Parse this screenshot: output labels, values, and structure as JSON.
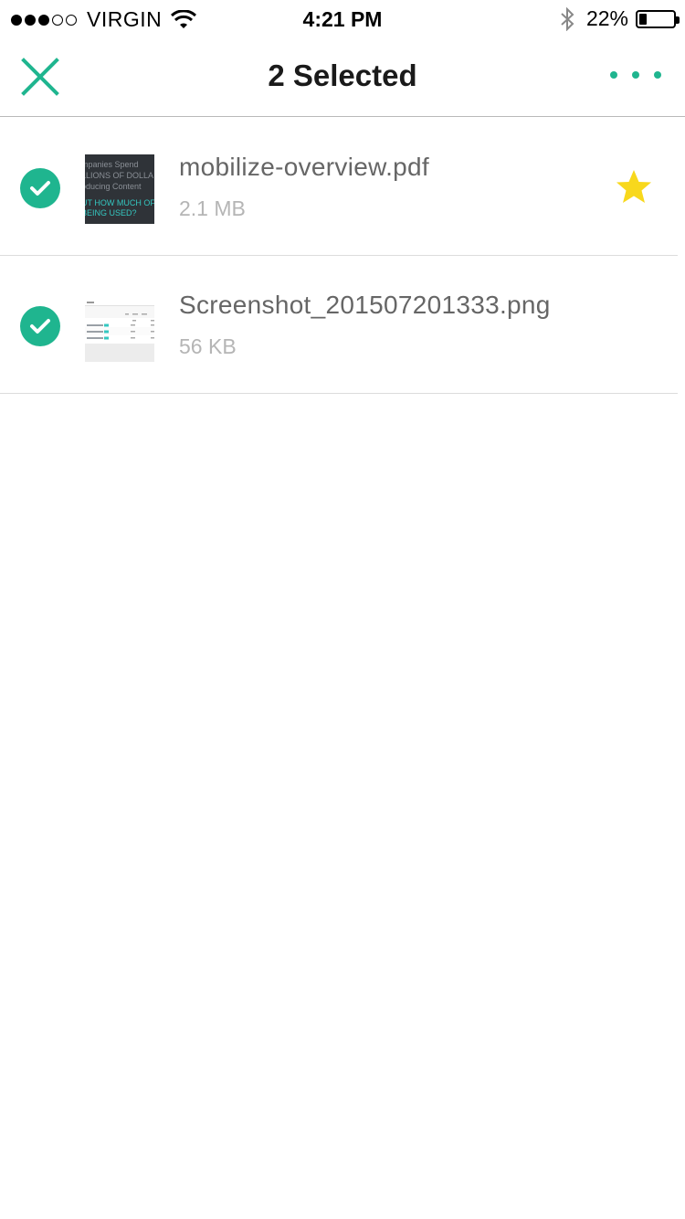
{
  "status_bar": {
    "carrier": "VIRGIN",
    "time": "4:21 PM",
    "battery_percent": "22%",
    "battery_level": 0.22,
    "signal_bars_filled": 3,
    "signal_bars_total": 5
  },
  "nav": {
    "title": "2 Selected",
    "close_icon": "close-icon",
    "more_icon": "more-options-icon"
  },
  "colors": {
    "accent": "#1fb58f",
    "star": "#f8d81c"
  },
  "files": [
    {
      "name": "mobilize-overview.pdf",
      "size": "2.1 MB",
      "selected": true,
      "starred": true,
      "thumbnail_lines": [
        "mpanies Spend",
        "LLIONS OF DOLLA",
        "oducing Content",
        "UT HOW MUCH OF",
        "BEING USED?"
      ]
    },
    {
      "name": "Screenshot_201507201333.png",
      "size": "56 KB",
      "selected": true,
      "starred": false
    }
  ]
}
